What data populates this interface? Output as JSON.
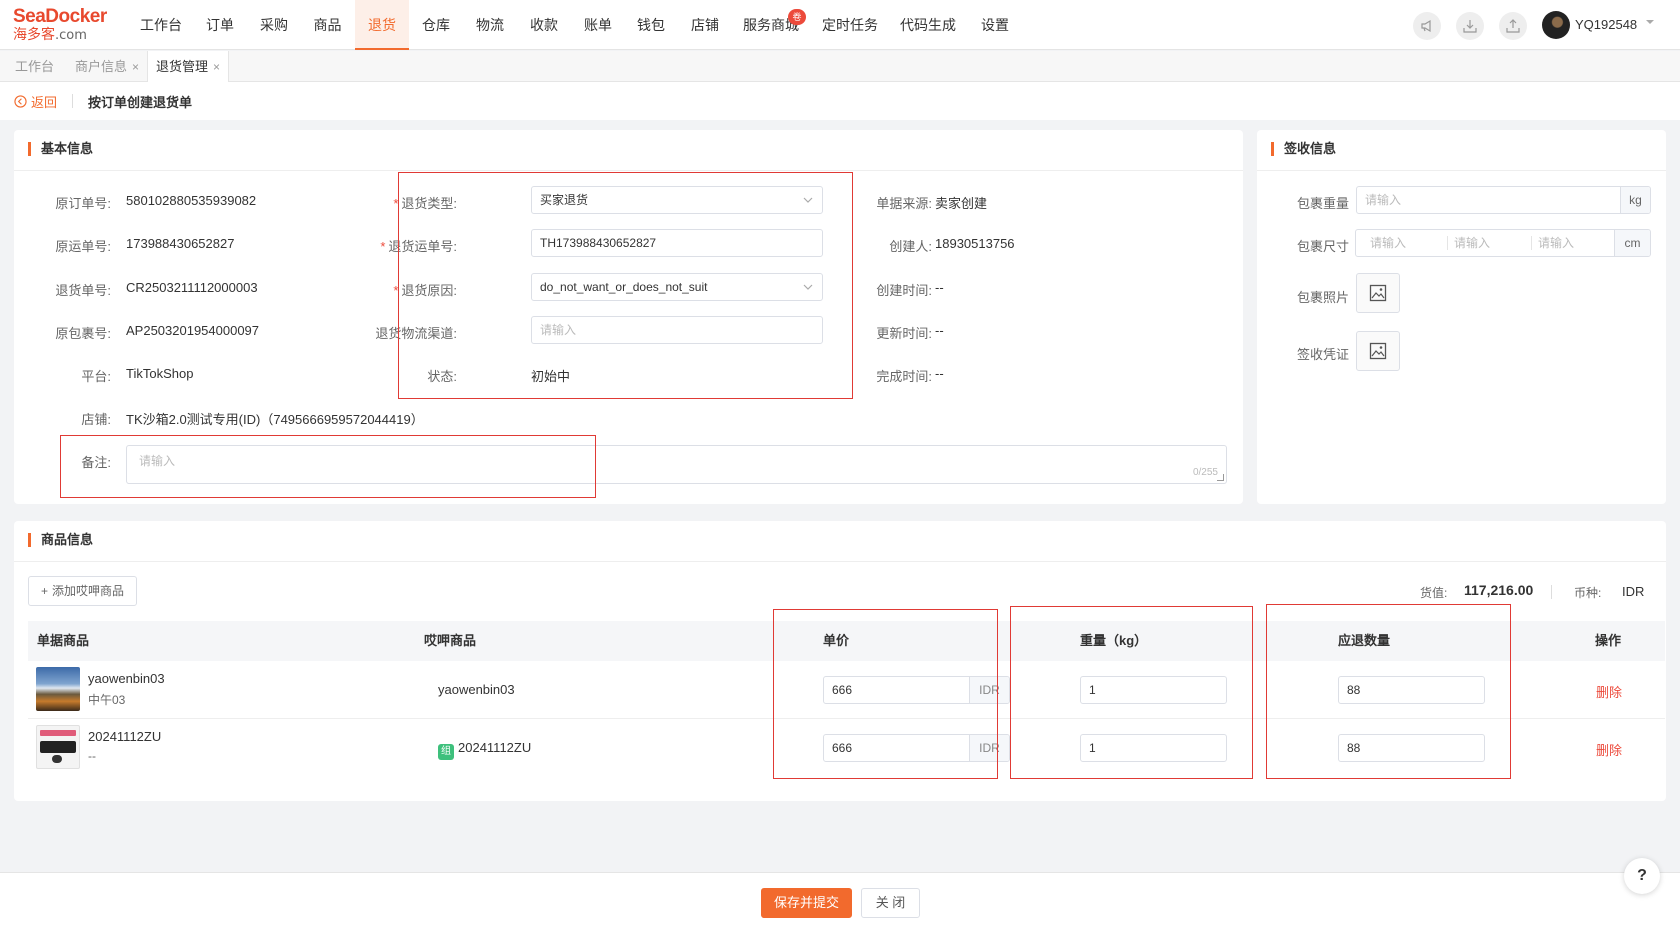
{
  "brand": {
    "top": "SeaDocker",
    "cn": "海多客",
    "suffix": ".com"
  },
  "nav": [
    {
      "label": "工作台"
    },
    {
      "label": "订单"
    },
    {
      "label": "采购"
    },
    {
      "label": "商品"
    },
    {
      "label": "退货"
    },
    {
      "label": "仓库"
    },
    {
      "label": "物流"
    },
    {
      "label": "收款"
    },
    {
      "label": "账单"
    },
    {
      "label": "钱包"
    },
    {
      "label": "店铺"
    },
    {
      "label": "服务商城"
    },
    {
      "label": "定时任务"
    },
    {
      "label": "代码生成"
    },
    {
      "label": "设置"
    }
  ],
  "nav_badge": "卷",
  "user": {
    "name": "YQ192548"
  },
  "tabs": [
    {
      "label": "工作台"
    },
    {
      "label": "商户信息"
    },
    {
      "label": "退货管理"
    }
  ],
  "header": {
    "back": "返回",
    "title": "按订单创建退货单"
  },
  "basic": {
    "title": "基本信息",
    "col1": [
      {
        "label": "原订单号:",
        "value": "580102880535939082"
      },
      {
        "label": "原运单号:",
        "value": "173988430652827"
      },
      {
        "label": "退货单号:",
        "value": "CR2503211112000003"
      },
      {
        "label": "原包裹号:",
        "value": "AP2503201954000097"
      },
      {
        "label": "平台:",
        "value": "TikTokShop"
      },
      {
        "label": "店铺:",
        "value": "TK沙箱2.0测试专用(ID)（7495666959572044419）"
      }
    ],
    "col2": {
      "return_type": {
        "label": "退货类型:",
        "value": "买家退货"
      },
      "tracking": {
        "label": "退货运单号:",
        "value": "TH173988430652827"
      },
      "reason": {
        "label": "退货原因:",
        "value": "do_not_want_or_does_not_suit"
      },
      "channel": {
        "label": "退货物流渠道:",
        "placeholder": "请输入"
      },
      "status": {
        "label": "状态:",
        "value": "初始中"
      }
    },
    "col3": [
      {
        "label": "单据来源:",
        "value": "卖家创建"
      },
      {
        "label": "创建人:",
        "value": "18930513756"
      },
      {
        "label": "创建时间:",
        "value": "--"
      },
      {
        "label": "更新时间:",
        "value": "--"
      },
      {
        "label": "完成时间:",
        "value": "--"
      }
    ],
    "remark": {
      "label": "备注:",
      "placeholder": "请输入",
      "count": "0/255"
    }
  },
  "sign": {
    "title": "签收信息",
    "weight": {
      "label": "包裹重量",
      "placeholder": "请输入",
      "unit": "kg"
    },
    "size": {
      "label": "包裹尺寸",
      "placeholder": "请输入",
      "unit": "cm"
    },
    "photo": {
      "label": "包裹照片"
    },
    "proof": {
      "label": "签收凭证"
    }
  },
  "products": {
    "title": "商品信息",
    "add_button": "添加哎呷商品",
    "summary": {
      "value_label": "货值:",
      "value": "117,216.00",
      "currency_label": "币种:",
      "currency": "IDR"
    },
    "columns": [
      "单据商品",
      "哎呷商品",
      "单价",
      "重量（kg）",
      "应退数量",
      "操作"
    ],
    "rows": [
      {
        "name": "yaowenbin03",
        "sub": "中午03",
        "mapped": "yaowenbin03",
        "combo": "",
        "price": "666",
        "currency": "IDR",
        "weight": "1",
        "qty": "88",
        "action": "删除"
      },
      {
        "name": "20241112ZU",
        "sub": "--",
        "mapped": "20241112ZU",
        "combo": "组",
        "price": "666",
        "currency": "IDR",
        "weight": "1",
        "qty": "88",
        "action": "删除"
      }
    ]
  },
  "footer": {
    "submit": "保存并提交",
    "close": "关 闭",
    "help": "?"
  },
  "colors": {
    "accent": "#f26a2d",
    "highlight": "#e03a35",
    "danger": "#ec4a3b"
  }
}
